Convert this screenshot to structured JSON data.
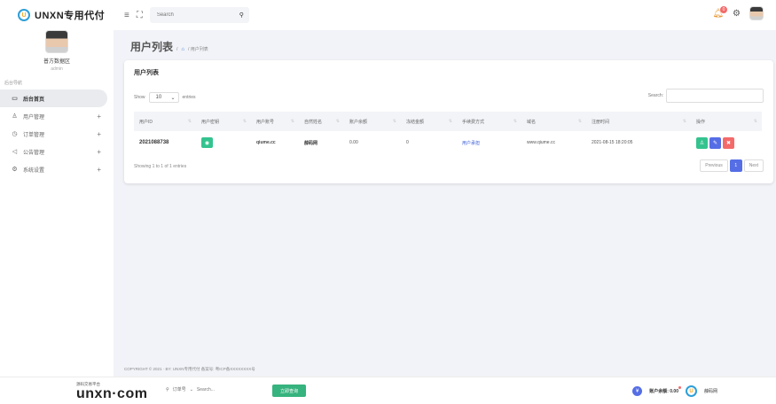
{
  "app": {
    "logo_text": "UNXN专用代付",
    "logo_mark": "U"
  },
  "profile": {
    "name": "普方数据区",
    "role": "admin"
  },
  "sidebar": {
    "section_label": "后台导航",
    "items": [
      {
        "label": "后台首页",
        "icon": "monitor-icon"
      },
      {
        "label": "用户管理",
        "icon": "user-icon"
      },
      {
        "label": "订单管理",
        "icon": "order-icon"
      },
      {
        "label": "公告管理",
        "icon": "speaker-icon"
      },
      {
        "label": "系统设置",
        "icon": "gear-icon"
      }
    ]
  },
  "topbar": {
    "search_placeholder": "Search",
    "notification_count": "0"
  },
  "page": {
    "title": "用户列表",
    "breadcrumb": "/ 用户列表"
  },
  "card": {
    "title": "用户列表",
    "show_label": "Show",
    "entries_value": "10",
    "entries_label": "entries",
    "search_label": "Search:",
    "columns": [
      "用户ID",
      "用户密钥",
      "用户账号",
      "自然姓名",
      "账户余额",
      "冻结金额",
      "手续费方式",
      "域名",
      "注册时间",
      "操作"
    ],
    "rows": [
      {
        "uid": "2021088738",
        "account": "qiume.cc",
        "name": "薛码网",
        "balance": "0.00",
        "frozen": "0",
        "fee_mode": "用户承担",
        "domain": "www.qiume.cc",
        "registered": "2021-08-15 18:20:05"
      }
    ],
    "info": "Showing 1 to 1 of 1 entries",
    "pager": {
      "previous": "Previous",
      "current": "1",
      "next": "Next"
    }
  },
  "footer": {
    "text": "COPYRIGHT © 2021 · BY: UNXN专用代付  备案号: 粤ICP备XXXXXXXX号"
  },
  "bottombar": {
    "brand_sub": "源码交易平台",
    "brand_main": "unxn·com",
    "filter_label": "订单号",
    "search_placeholder": "Search...",
    "query_button": "立即查询",
    "balance_label": "账户余额: 0.00",
    "site_name": "薛码网"
  },
  "colors": {
    "accent": "#556ee6",
    "success": "#34c38f",
    "danger": "#f46a6a",
    "brand_ring": "#2e9fd8"
  }
}
